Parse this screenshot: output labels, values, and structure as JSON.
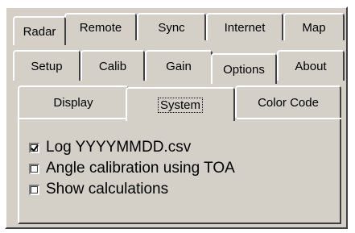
{
  "tabs": {
    "row1": [
      "Radar",
      "Remote",
      "Sync",
      "Internet",
      "Map"
    ],
    "row2": [
      "Setup",
      "Calib",
      "Gain",
      "Options",
      "About"
    ],
    "row3": [
      "Display",
      "System",
      "Color Code"
    ]
  },
  "options": {
    "log": {
      "label": "Log YYYYMMDD.csv",
      "checked": true
    },
    "angle": {
      "label": "Angle calibration using TOA",
      "checked": false
    },
    "calc": {
      "label": "Show calculations",
      "checked": false
    }
  },
  "colors": {
    "face": "#d4d0c8",
    "highlight": "#ffffff",
    "shadow": "#404040"
  },
  "icons": {
    "checked": "checkmark-icon"
  }
}
